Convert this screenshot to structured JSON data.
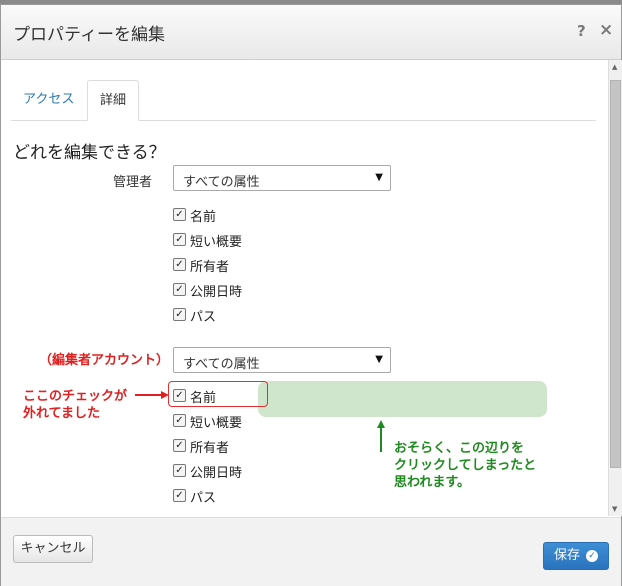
{
  "dialog": {
    "title": "プロパティーを編集",
    "help_icon": "?",
    "close_icon": "×"
  },
  "tabs": [
    {
      "label": "アクセス",
      "active": false
    },
    {
      "label": "詳細",
      "active": true
    }
  ],
  "section": {
    "heading": "どれを編集できる？"
  },
  "groups": [
    {
      "label": "管理者",
      "select_value": "すべての属性",
      "checkboxes": [
        {
          "label": "名前",
          "checked": true
        },
        {
          "label": "短い概要",
          "checked": true
        },
        {
          "label": "所有者",
          "checked": true
        },
        {
          "label": "公開日時",
          "checked": true
        },
        {
          "label": "パス",
          "checked": true
        }
      ]
    },
    {
      "label": "（編集者アカウント）",
      "select_value": "すべての属性",
      "checkboxes": [
        {
          "label": "名前",
          "checked": true
        },
        {
          "label": "短い概要",
          "checked": true
        },
        {
          "label": "所有者",
          "checked": true
        },
        {
          "label": "公開日時",
          "checked": true
        },
        {
          "label": "パス",
          "checked": true
        }
      ]
    }
  ],
  "annotations": {
    "red_note_line1": "ここのチェックが",
    "red_note_line2": "外れてました",
    "green_note_line1": "おそらく、この辺りを",
    "green_note_line2": "クリックしてしまったと",
    "green_note_line3": "思われます。",
    "red_color": "#e02020",
    "green_color": "#1f8a1f",
    "highlight_color": "#cfe6cc"
  },
  "footer": {
    "cancel_label": "キャンセル",
    "save_label": "保存"
  },
  "colors": {
    "tab_link": "#2a7ab0",
    "save_button": "#2a73bd"
  }
}
